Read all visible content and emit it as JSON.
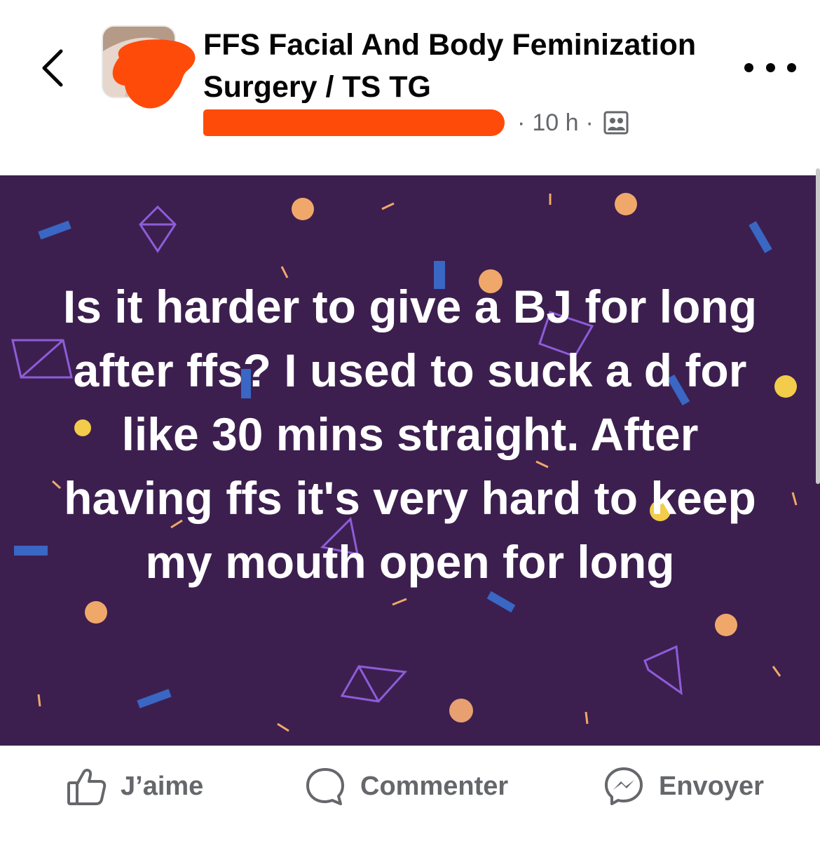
{
  "header": {
    "group_name": "FFS Facial And Body Feminization Surgery / TS TG",
    "time": "10 h",
    "separator": "·",
    "icons": {
      "back": "chevron-left-icon",
      "more": "more-dots-icon",
      "audience": "group-audience-icon"
    }
  },
  "post": {
    "text": "Is it harder to give a BJ for long after ffs? I used to suck a d for like 30 mins straight. After having ffs it's very hard to keep my mouth open for long",
    "background_color": "#3c1f4f"
  },
  "actions": {
    "like_label": "J’aime",
    "comment_label": "Commenter",
    "send_label": "Envoyer",
    "icons": {
      "like": "thumbs-up-icon",
      "comment": "comment-bubble-icon",
      "send": "messenger-icon"
    }
  },
  "colors": {
    "redaction": "#ff4b0a",
    "secondary_text": "#65676b",
    "post_bg": "#3c1f4f"
  }
}
